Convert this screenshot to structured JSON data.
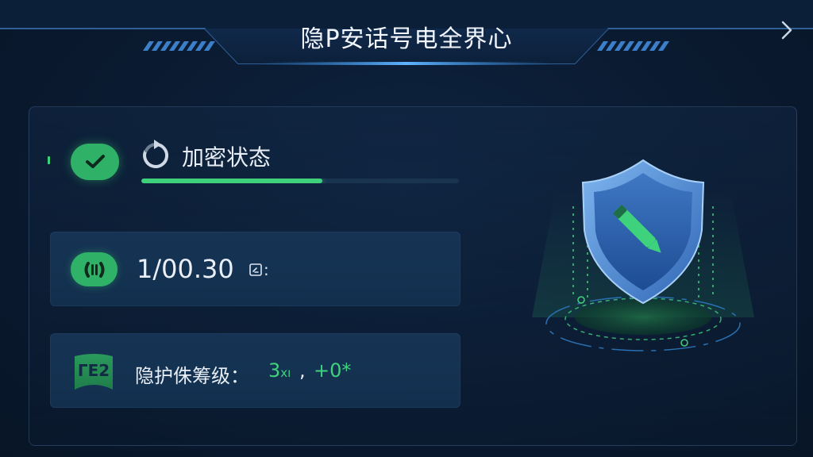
{
  "header": {
    "title": "隐P安话号电全界心",
    "next_icon": "chevron-right-icon"
  },
  "status": {
    "label": "加密状态",
    "progress": 0.57,
    "check_icon": "check-icon",
    "refresh_icon": "refresh-icon"
  },
  "time_card": {
    "value": "1/00.30",
    "suffix": ":",
    "icon": "pause-icon",
    "trailing_icon": "document-icon"
  },
  "level_card": {
    "badge": "ΓE2",
    "label": "隐护侏筹级：",
    "value": "3",
    "value_unit": "xı",
    "separator": ",",
    "value2": "+0*"
  },
  "shield": {
    "icon": "shield-pen-icon"
  },
  "colors": {
    "accent_green": "#2fb268",
    "bright_green": "#3fd27d",
    "shield_blue": "#3f7fd0",
    "background": "#0a1a30"
  }
}
